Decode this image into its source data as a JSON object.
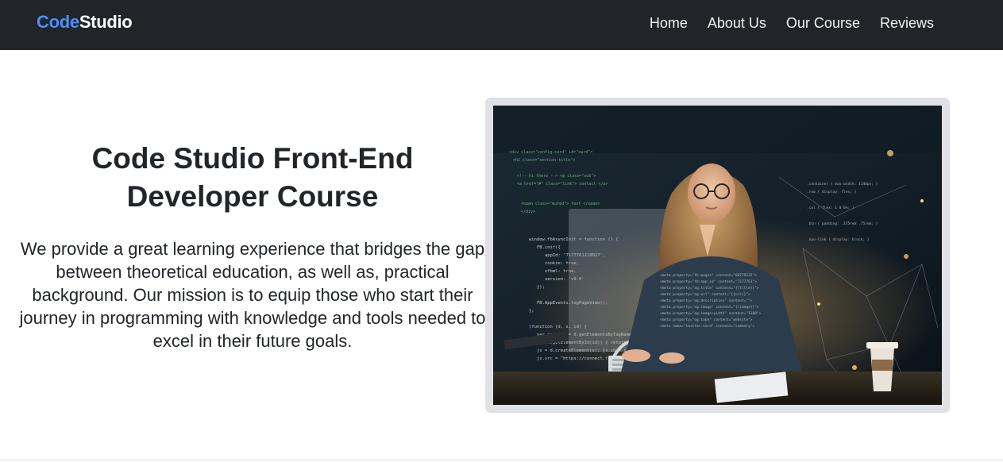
{
  "brand": {
    "part1": "Code",
    "part2": "Studio"
  },
  "nav": {
    "items": [
      {
        "label": "Home"
      },
      {
        "label": "About Us"
      },
      {
        "label": "Our Course"
      },
      {
        "label": "Reviews"
      }
    ]
  },
  "hero": {
    "title": "Code Studio Front-End Developer Course",
    "description": "We provide a great learning experience that bridges the gap between theoretical education, as well as, practical background. Our mission is to equip those who start their journey in programming with knowledge and tools needed to excel in their future goals."
  },
  "colors": {
    "navbar_bg": "#212529",
    "brand_accent": "#4f8cf6",
    "text": "#212529",
    "image_frame": "#dfe1e4"
  }
}
